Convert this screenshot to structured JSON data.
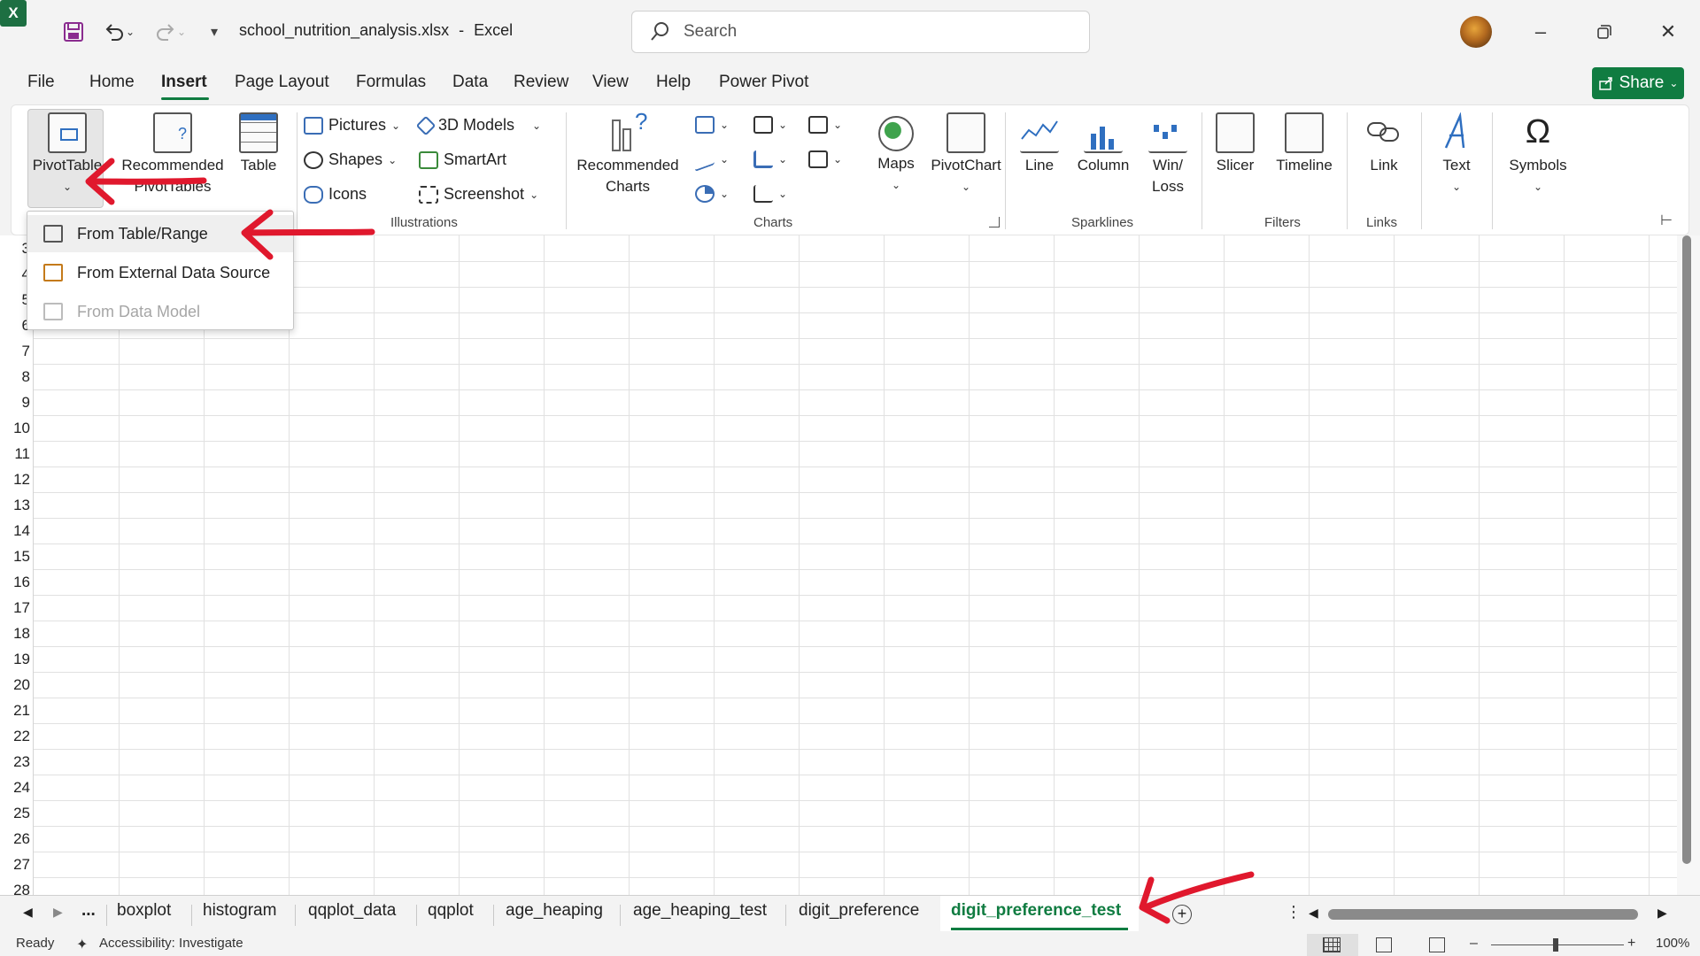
{
  "titlebar": {
    "file_name": "school_nutrition_analysis.xlsx",
    "separator": "-",
    "app_name": "Excel",
    "search_placeholder": "Search"
  },
  "menu": {
    "tabs": [
      "File",
      "Home",
      "Insert",
      "Page Layout",
      "Formulas",
      "Data",
      "Review",
      "View",
      "Help",
      "Power Pivot"
    ],
    "active": "Insert",
    "share_label": "Share"
  },
  "ribbon": {
    "tables": {
      "pivottable": "PivotTable",
      "recommended_line1": "Recommended",
      "recommended_line2": "PivotTables",
      "table": "Table"
    },
    "illustrations": {
      "pictures": "Pictures",
      "shapes": "Shapes",
      "icons": "Icons",
      "models": "3D Models",
      "smartart": "SmartArt",
      "screenshot": "Screenshot",
      "label": "Illustrations"
    },
    "charts": {
      "recommended_line1": "Recommended",
      "recommended_line2": "Charts",
      "maps": "Maps",
      "pivotchart": "PivotChart",
      "label": "Charts"
    },
    "sparklines": {
      "line": "Line",
      "column": "Column",
      "winloss_line1": "Win/",
      "winloss_line2": "Loss",
      "label": "Sparklines"
    },
    "filters": {
      "slicer": "Slicer",
      "timeline": "Timeline",
      "label": "Filters"
    },
    "links": {
      "link": "Link",
      "label": "Links"
    },
    "text": {
      "text": "Text"
    },
    "symbols": {
      "symbols": "Symbols"
    }
  },
  "dropdown": {
    "items": [
      {
        "label": "From Table/Range",
        "state": "highlighted"
      },
      {
        "label": "From External Data Source",
        "state": "enabled"
      },
      {
        "label": "From Data Model",
        "state": "disabled"
      }
    ]
  },
  "grid": {
    "rows": [
      "3",
      "4",
      "5",
      "6",
      "7",
      "8",
      "9",
      "10",
      "11",
      "12",
      "13",
      "14",
      "15",
      "16",
      "17",
      "18",
      "19",
      "20",
      "21",
      "22",
      "23",
      "24",
      "25",
      "26",
      "27",
      "28"
    ]
  },
  "sheet_tabs": {
    "more": "...",
    "tabs": [
      "boxplot",
      "histogram",
      "qqplot_data",
      "qqplot",
      "age_heaping",
      "age_heaping_test",
      "digit_preference",
      "digit_preference_test"
    ],
    "active": "digit_preference_test"
  },
  "status": {
    "ready": "Ready",
    "accessibility": "Accessibility: Investigate",
    "zoom": "100%"
  },
  "colors": {
    "accent": "#107c41",
    "annotation_arrow": "#e0182d"
  }
}
